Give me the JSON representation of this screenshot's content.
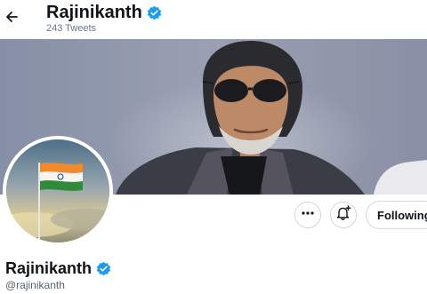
{
  "header": {
    "name": "Rajinikanth",
    "tweets": "243 Tweets"
  },
  "profile": {
    "name": "Rajinikanth",
    "handle": "@rajinikanth"
  },
  "actions": {
    "more_icon": "more-dots-icon",
    "notify_icon": "bell-plus-icon",
    "follow_label": "Following"
  },
  "colors": {
    "verified": "#1d9bf0",
    "text": "#0f1419",
    "secondary": "#536471",
    "border": "#cfd9de"
  }
}
